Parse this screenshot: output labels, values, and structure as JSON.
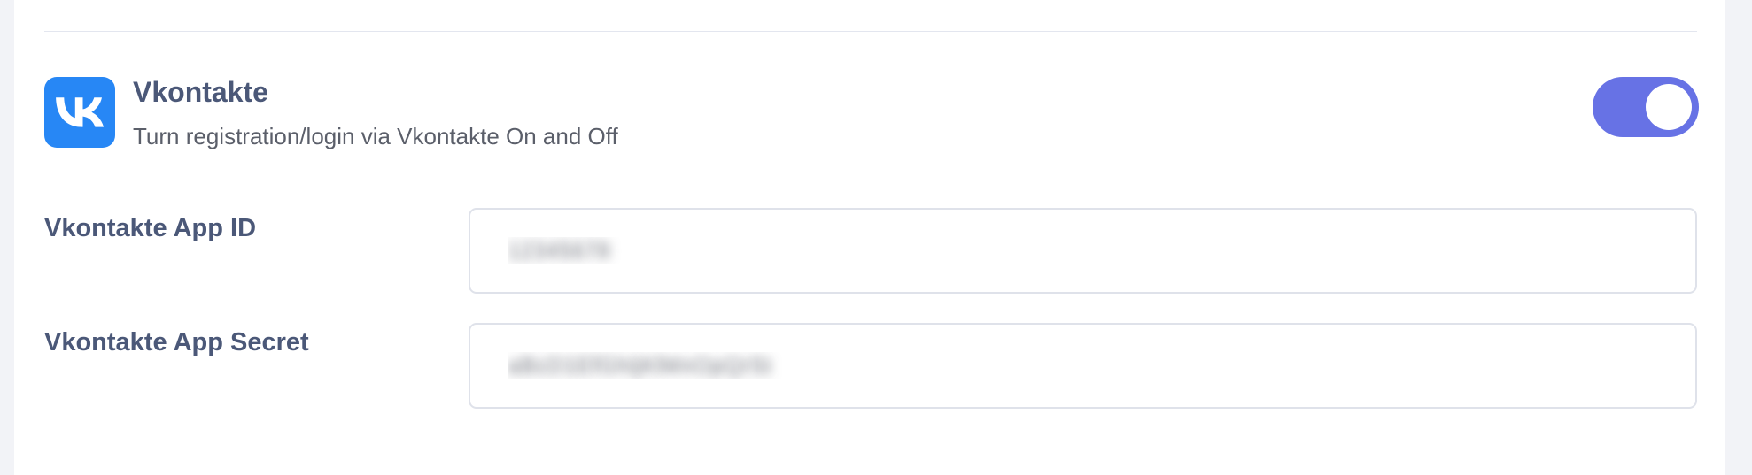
{
  "provider": {
    "name": "Vkontakte",
    "icon": "vk-logo-icon",
    "brand_color": "#2787f5",
    "description": "Turn registration/login via Vkontakte On and Off",
    "enabled": true,
    "toggle_color": "#6772e5"
  },
  "fields": {
    "app_id": {
      "label": "Vkontakte App ID",
      "value": "12345678"
    },
    "app_secret": {
      "label": "Vkontakte App Secret",
      "value": "aBcD1EfGhIjKlMnOpQrSt"
    }
  }
}
